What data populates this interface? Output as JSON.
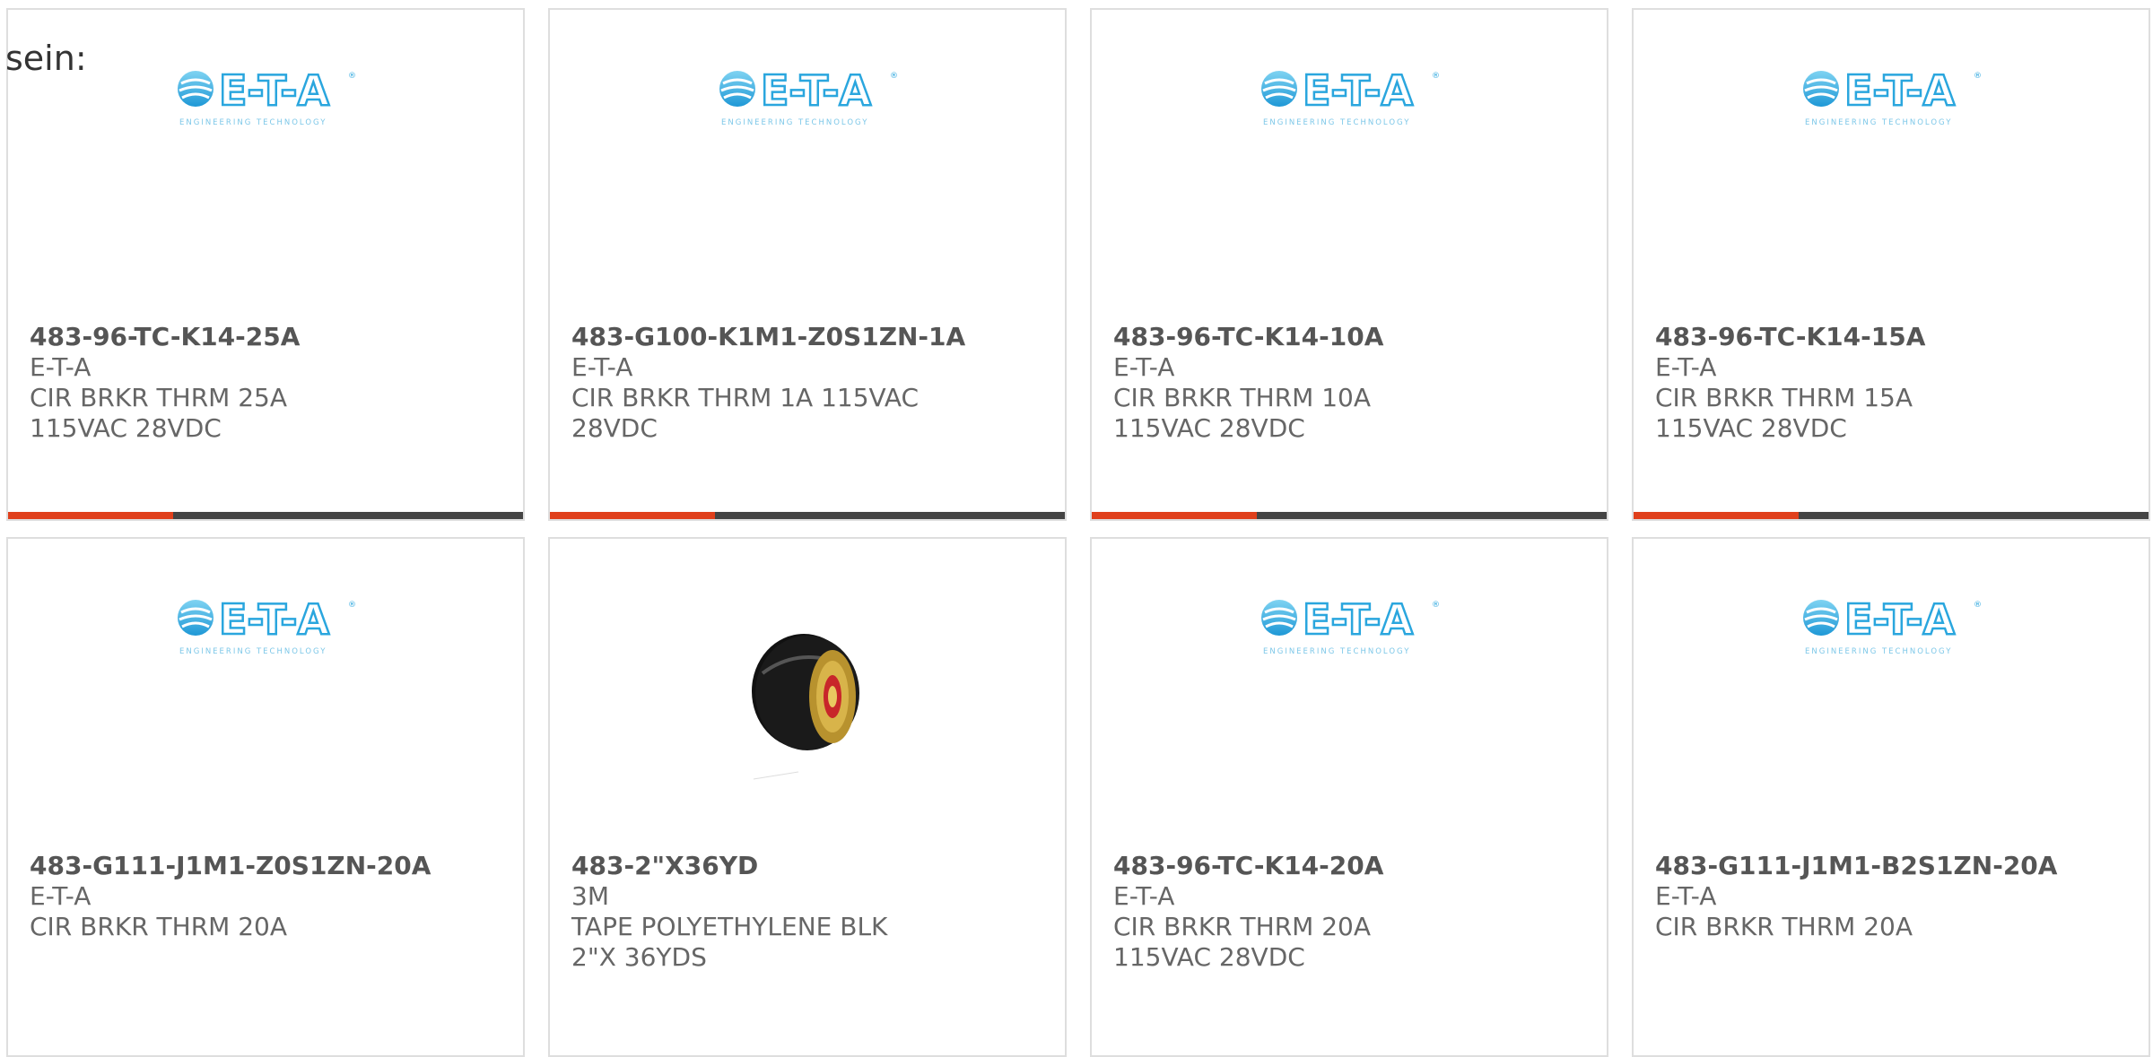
{
  "intro": "sein:",
  "colors": {
    "progress_fill": "#e0401c",
    "progress_track": "#444444",
    "eta_blue": "#3aaee0"
  },
  "products": [
    {
      "part": "483-96-TC-K14-25A",
      "brand": "E-T-A",
      "description": "CIR BRKR THRM 25A 115VAC 28VDC",
      "image": "eta-logo",
      "progress": 0.32
    },
    {
      "part": "483-G100-K1M1-Z0S1ZN-1A",
      "brand": "E-T-A",
      "description": "CIR BRKR THRM 1A 115VAC 28VDC",
      "image": "eta-logo",
      "progress": 0.32
    },
    {
      "part": "483-96-TC-K14-10A",
      "brand": "E-T-A",
      "description": "CIR BRKR THRM 10A 115VAC 28VDC",
      "image": "eta-logo",
      "progress": 0.32
    },
    {
      "part": "483-96-TC-K14-15A",
      "brand": "E-T-A",
      "description": "CIR BRKR THRM 15A 115VAC 28VDC",
      "image": "eta-logo",
      "progress": 0.32
    },
    {
      "part": "483-G111-J1M1-Z0S1ZN-20A",
      "brand": "E-T-A",
      "description": "CIR BRKR THRM 20A",
      "image": "eta-logo"
    },
    {
      "part": "483-2\"X36YD",
      "brand": "3M",
      "description": "TAPE POLYETHYLENE BLK 2\"X 36YDS",
      "image": "tape-roll"
    },
    {
      "part": "483-96-TC-K14-20A",
      "brand": "E-T-A",
      "description": "CIR BRKR THRM 20A 115VAC 28VDC",
      "image": "eta-logo"
    },
    {
      "part": "483-G111-J1M1-B2S1ZN-20A",
      "brand": "E-T-A",
      "description": "CIR BRKR THRM 20A",
      "image": "eta-logo"
    }
  ]
}
